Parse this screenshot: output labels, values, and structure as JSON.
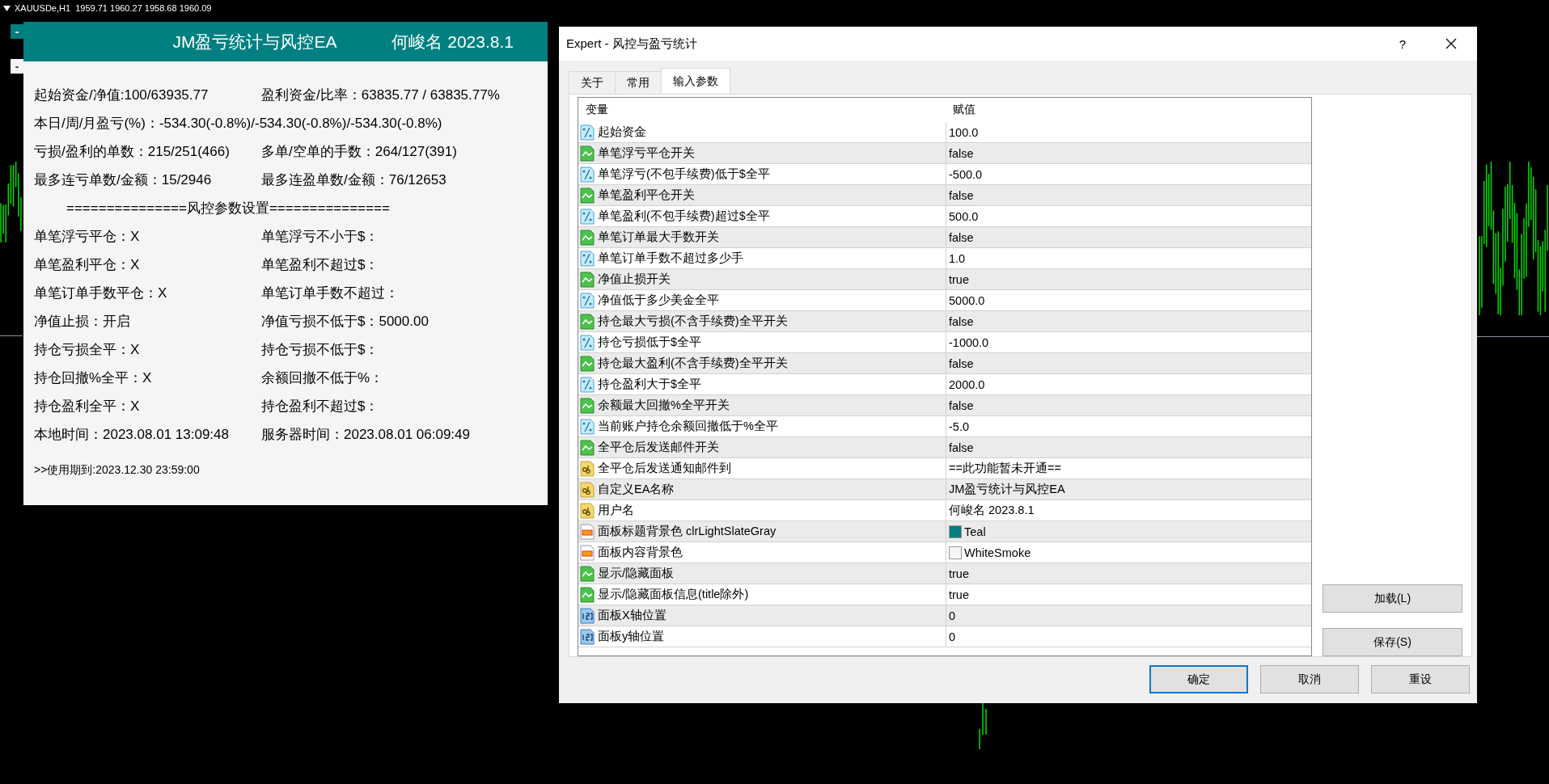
{
  "chart": {
    "symbol_info": "XAUUSDe,H1  1959.71 1960.27 1958.68 1960.09",
    "buttons": [
      {
        "label": "-",
        "kind": "teal"
      },
      {
        "label": "-",
        "kind": "plain"
      }
    ]
  },
  "panel": {
    "title": "JM盈亏统计与风控EA",
    "user": "何峻名 2023.8.1",
    "rows": [
      {
        "kind": "pair",
        "left": "起始资金/净值:100/63935.77",
        "right": "盈利资金/比率：63835.77 / 63835.77%"
      },
      {
        "kind": "line",
        "text": "本日/周/月盈亏(%)：-534.30(-0.8%)/-534.30(-0.8%)/-534.30(-0.8%)"
      },
      {
        "kind": "pair",
        "left": "亏损/盈利的单数：215/251(466)",
        "right": "多单/空单的手数：264/127(391)"
      },
      {
        "kind": "pair",
        "left": "最多连亏单数/金额：15/2946",
        "right": "最多连盈单数/金额：76/12653"
      },
      {
        "kind": "divider",
        "text": "===============风控参数设置==============="
      },
      {
        "kind": "pair",
        "left": "单笔浮亏平仓：X",
        "right": "单笔浮亏不小于$："
      },
      {
        "kind": "pair",
        "left": "单笔盈利平仓：X",
        "right": "单笔盈利不超过$："
      },
      {
        "kind": "pair",
        "left": "单笔订单手数平仓：X",
        "right": "单笔订单手数不超过："
      },
      {
        "kind": "pair",
        "left": "净值止损：开启",
        "right": "净值亏损不低于$：5000.00"
      },
      {
        "kind": "pair",
        "left": "持仓亏损全平：X",
        "right": "持仓亏损不低于$："
      },
      {
        "kind": "pair",
        "left": "持仓回撤%全平：X",
        "right": "余额回撤不低于%："
      },
      {
        "kind": "pair",
        "left": "持仓盈利全平：X",
        "right": "持仓盈利不超过$："
      },
      {
        "kind": "pair",
        "left": "本地时间：2023.08.01 13:09:48",
        "right": "服务器时间：2023.08.01 06:09:49"
      }
    ],
    "footer": ">>使用期到:2023.12.30 23:59:00"
  },
  "dialog": {
    "title": "Expert - 风控与盈亏统计",
    "help_button": "?",
    "tabs": [
      {
        "label": "关于",
        "selected": false
      },
      {
        "label": "常用",
        "selected": false
      },
      {
        "label": "输入参数",
        "selected": true
      }
    ],
    "table": {
      "columns": [
        "变量",
        "赋值"
      ],
      "rows": [
        {
          "kind": "double",
          "name": "起始资金",
          "value": "100.0"
        },
        {
          "kind": "bool",
          "name": "单笔浮亏平仓开关",
          "value": "false"
        },
        {
          "kind": "double",
          "name": "单笔浮亏(不包手续费)低于$全平",
          "value": "-500.0"
        },
        {
          "kind": "bool",
          "name": "单笔盈利平仓开关",
          "value": "false"
        },
        {
          "kind": "double",
          "name": "单笔盈利(不包手续费)超过$全平",
          "value": "500.0"
        },
        {
          "kind": "bool",
          "name": "单笔订单最大手数开关",
          "value": "false"
        },
        {
          "kind": "double",
          "name": "单笔订单手数不超过多少手",
          "value": "1.0"
        },
        {
          "kind": "bool",
          "name": "净值止损开关",
          "value": "true"
        },
        {
          "kind": "double",
          "name": "净值低于多少美金全平",
          "value": "5000.0"
        },
        {
          "kind": "bool",
          "name": "持仓最大亏损(不含手续费)全平开关",
          "value": "false"
        },
        {
          "kind": "double",
          "name": "持仓亏损低于$全平",
          "value": "-1000.0"
        },
        {
          "kind": "bool",
          "name": "持仓最大盈利(不含手续费)全平开关",
          "value": "false"
        },
        {
          "kind": "double",
          "name": "持仓盈利大于$全平",
          "value": "2000.0"
        },
        {
          "kind": "bool",
          "name": "余额最大回撤%全平开关",
          "value": "false"
        },
        {
          "kind": "double",
          "name": "当前账户持仓余额回撤低于%全平",
          "value": "-5.0"
        },
        {
          "kind": "bool",
          "name": "全平仓后发送邮件开关",
          "value": "false"
        },
        {
          "kind": "string",
          "name": "全平仓后发送通知邮件到",
          "value": "==此功能暂未开通=="
        },
        {
          "kind": "string",
          "name": "自定义EA名称",
          "value": "JM盈亏统计与风控EA"
        },
        {
          "kind": "string",
          "name": "用户名",
          "value": "何峻名 2023.8.1"
        },
        {
          "kind": "color",
          "name": "面板标题背景色 clrLightSlateGray",
          "value": "Teal",
          "color": "#008080"
        },
        {
          "kind": "color",
          "name": "面板内容背景色",
          "value": "WhiteSmoke",
          "color": "#f5f5f5"
        },
        {
          "kind": "bool",
          "name": "显示/隐藏面板",
          "value": "true"
        },
        {
          "kind": "bool",
          "name": "显示/隐藏面板信息(title除外)",
          "value": "true"
        },
        {
          "kind": "int",
          "name": "面板X轴位置",
          "value": "0"
        },
        {
          "kind": "int",
          "name": "面板y轴位置",
          "value": "0"
        }
      ]
    },
    "side_buttons": [
      "加载(L)",
      "保存(S)"
    ],
    "buttons": [
      {
        "label": "确定",
        "default": true
      },
      {
        "label": "取消",
        "default": false
      },
      {
        "label": "重设",
        "default": false
      }
    ]
  }
}
